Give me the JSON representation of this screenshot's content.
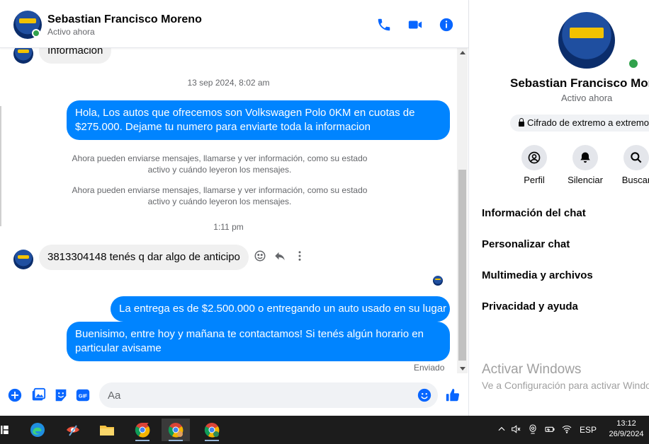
{
  "header": {
    "name": "Sebastian Francisco Moreno",
    "status": "Activo ahora"
  },
  "messages": {
    "partial_incoming": "Información",
    "timestamp1": "13 sep 2024, 8:02 am",
    "out1": "Hola, Los autos que ofrecemos son Volkswagen Polo 0KM en cuotas de $275.000. Dejame tu numero para enviarte toda la informacion",
    "system1": "Ahora pueden enviarse mensajes, llamarse y ver información, como su estado activo y cuándo leyeron los mensajes.",
    "system2": "Ahora pueden enviarse mensajes, llamarse y ver información, como su estado activo y cuándo leyeron los mensajes.",
    "timestamp2": "1:11 pm",
    "in1": "3813304148 tenés q dar algo de anticipo",
    "out2": "La entrega es de $2.500.000 o entregando un auto usado en su lugar",
    "out3": "Buenisimo, entre hoy y mañana te contactamos! Si tenés algún horario en particular avisame",
    "sent_status": "Enviado"
  },
  "composer": {
    "placeholder": "Aa"
  },
  "info": {
    "name": "Sebastian Francisco Moreno",
    "status": "Activo ahora",
    "encryption": "Cifrado de extremo a extremo",
    "actions": [
      {
        "label": "Perfil",
        "icon": "profile-icon"
      },
      {
        "label": "Silenciar",
        "icon": "bell-icon"
      },
      {
        "label": "Buscar",
        "icon": "search-icon"
      }
    ],
    "menu": [
      "Información del chat",
      "Personalizar chat",
      "Multimedia y archivos",
      "Privacidad y ayuda"
    ]
  },
  "watermark": {
    "title": "Activar Windows",
    "subtitle": "Ve a Configuración para activar Windows."
  },
  "taskbar": {
    "language": "ESP",
    "time": "13:12",
    "date": "26/9/2024"
  },
  "colors": {
    "accent": "#0866ff",
    "outgoing_bubble": "#0084ff",
    "incoming_bubble": "#f0f0f0",
    "online": "#31a24c",
    "taskbar": "#1c1c1c"
  }
}
